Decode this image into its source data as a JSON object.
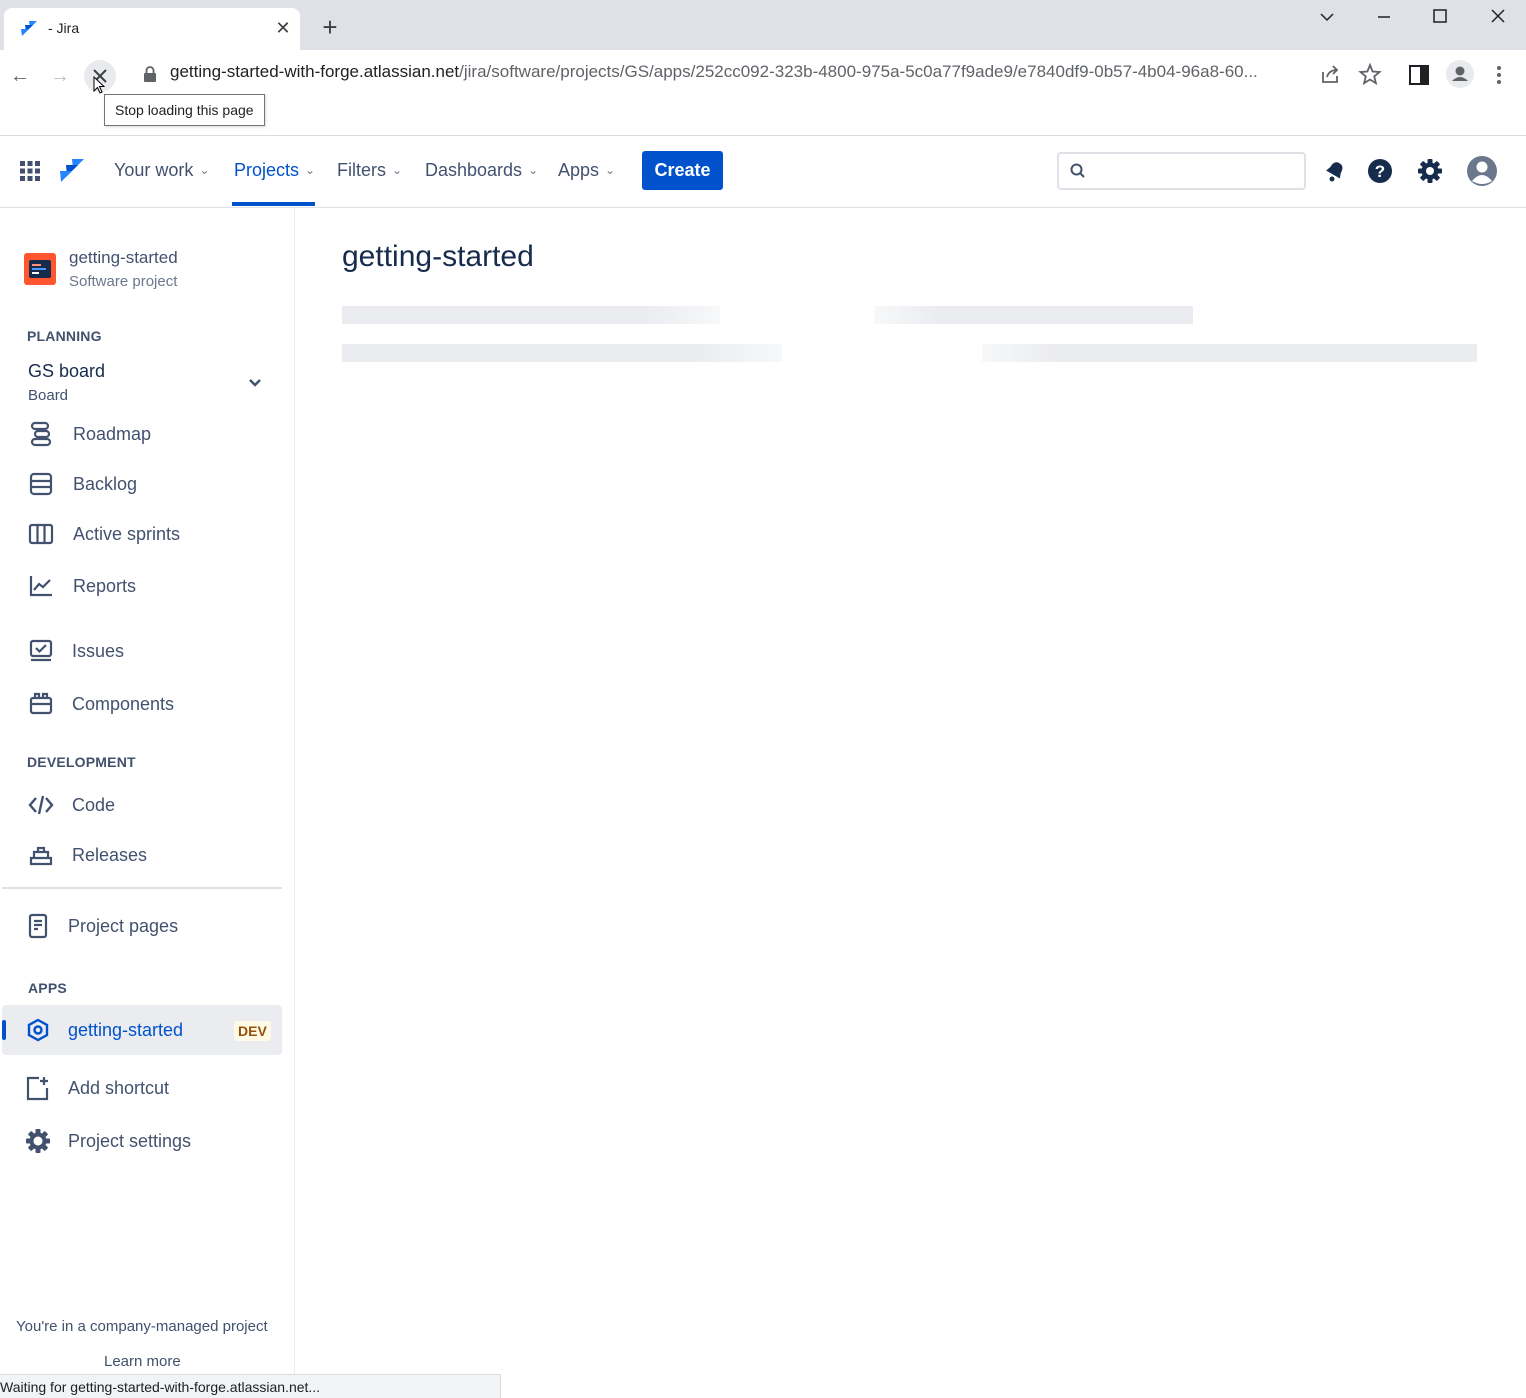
{
  "browser": {
    "tab_title": "- Jira",
    "url_host": "getting-started-with-forge.atlassian.net",
    "url_path": "/jira/software/projects/GS/apps/252cc092-323b-4800-975a-5c0a77f9ade9/e7840df9-0b57-4b04-96a8-60...",
    "tooltip": "Stop loading this page",
    "status_text": "Waiting for getting-started-with-forge.atlassian.net..."
  },
  "topnav": {
    "items": [
      "Your work",
      "Projects",
      "Filters",
      "Dashboards",
      "Apps"
    ],
    "active": "Projects",
    "create_label": "Create",
    "search_placeholder": "",
    "accent": "#0052cc"
  },
  "sidebar": {
    "project_name": "getting-started",
    "project_type": "Software project",
    "planning_heading": "PLANNING",
    "board_name": "GS board",
    "board_type": "Board",
    "planning_items": [
      {
        "label": "Roadmap",
        "icon": "roadmap-icon"
      },
      {
        "label": "Backlog",
        "icon": "backlog-icon"
      },
      {
        "label": "Active sprints",
        "icon": "board-icon"
      },
      {
        "label": "Reports",
        "icon": "reports-icon"
      }
    ],
    "other_items": [
      {
        "label": "Issues",
        "icon": "issues-icon"
      },
      {
        "label": "Components",
        "icon": "components-icon"
      }
    ],
    "development_heading": "DEVELOPMENT",
    "development_items": [
      {
        "label": "Code",
        "icon": "code-icon"
      },
      {
        "label": "Releases",
        "icon": "releases-icon"
      }
    ],
    "project_pages": "Project pages",
    "apps_heading": "APPS",
    "app_name": "getting-started",
    "app_badge": "DEV",
    "add_shortcut": "Add shortcut",
    "project_settings": "Project settings",
    "footer_text": "You're in a company-managed project",
    "learn_more": "Learn more"
  },
  "main": {
    "title": "getting-started"
  }
}
